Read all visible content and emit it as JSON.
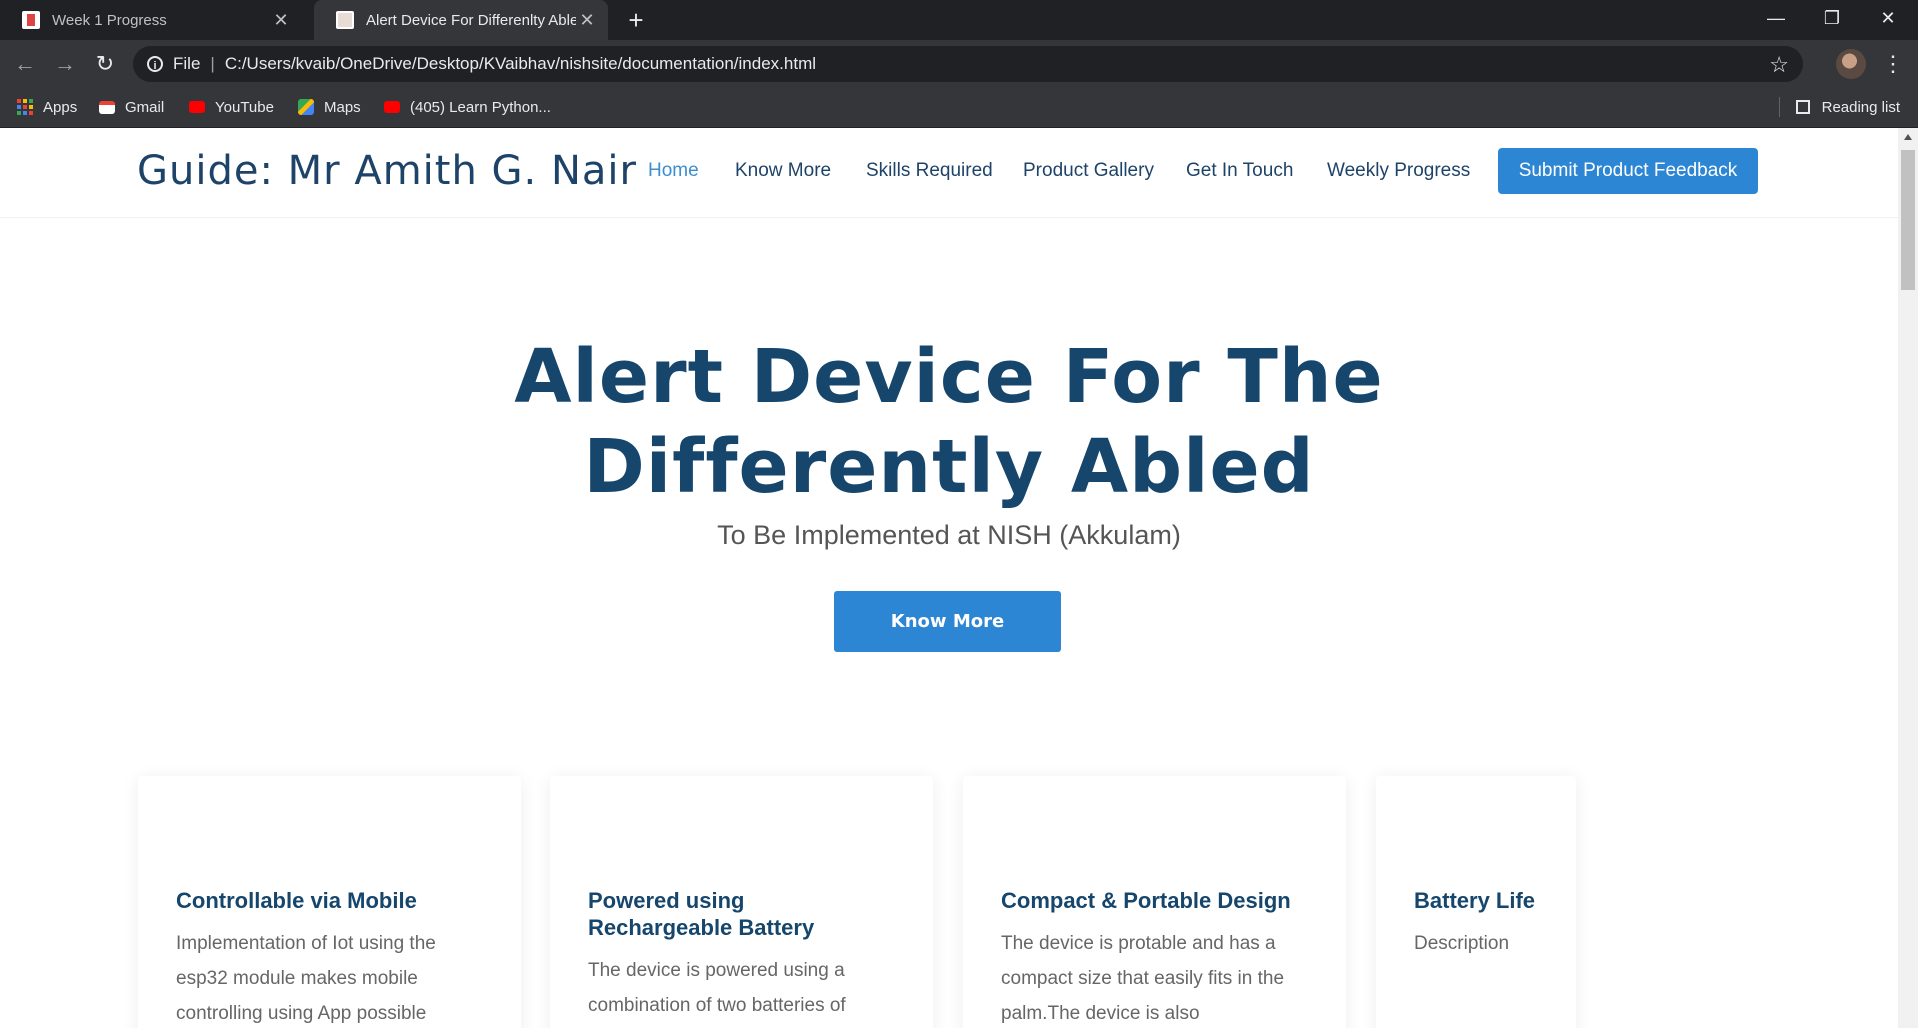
{
  "browser": {
    "tabs": [
      {
        "title": "Week 1 Progress",
        "favicon_color": "#d44"
      },
      {
        "title": "Alert Device For Differenlty Abled",
        "favicon_color": "#b88"
      }
    ],
    "address": {
      "scheme_label": "File",
      "url": "C:/Users/kvaib/OneDrive/Desktop/KVaibhav/nishsite/documentation/index.html"
    },
    "bookmarks": [
      {
        "label": "Apps",
        "icon": "apps-grid-icon"
      },
      {
        "label": "Gmail",
        "icon": "gmail-icon"
      },
      {
        "label": "YouTube",
        "icon": "youtube-icon"
      },
      {
        "label": "Maps",
        "icon": "maps-icon"
      },
      {
        "label": "(405) Learn Python...",
        "icon": "youtube-icon"
      }
    ],
    "reading_list": "Reading list"
  },
  "header": {
    "logo": "Guide: Mr Amith G. Nair",
    "nav": [
      "Home",
      "Know More",
      "Skills Required",
      "Product Gallery",
      "Get In Touch",
      "Weekly Progress"
    ],
    "cta": "Submit Product Feedback"
  },
  "hero": {
    "title_line1": "Alert Device For The",
    "title_line2": "Differently Abled",
    "subtitle": "To Be Implemented at NISH (Akkulam)",
    "button": "Know More"
  },
  "features": [
    {
      "title_lines": [
        "Controllable via Mobile"
      ],
      "text_lines": [
        "Implementation of Iot using the",
        "esp32 module makes mobile",
        "controlling using App possible"
      ]
    },
    {
      "title_lines": [
        "Powered using",
        "Rechargeable Battery"
      ],
      "text_lines": [
        "The device is powered using a",
        "combination of two batteries of"
      ]
    },
    {
      "title_lines": [
        "Compact & Portable Design"
      ],
      "text_lines": [
        "The device is protable and has a",
        "compact size that easily fits in the",
        "palm.The device is also"
      ]
    },
    {
      "title_lines": [
        "Battery Life"
      ],
      "text_lines": [
        "Description"
      ]
    }
  ],
  "colors": {
    "primary": "#2c86d3",
    "heading": "#17466d",
    "nav_active": "#3b8fd0"
  }
}
